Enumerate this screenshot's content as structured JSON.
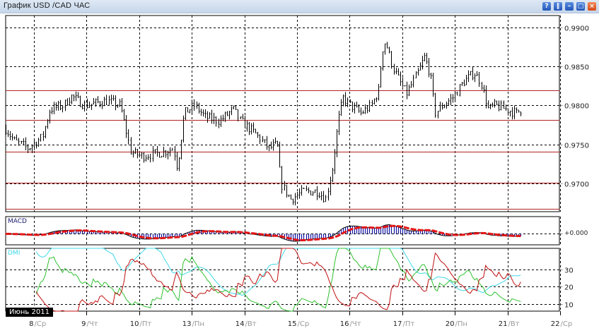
{
  "window": {
    "title": "График USD /CAD  ЧАС",
    "buttons": [
      {
        "name": "help",
        "glyph": "?"
      },
      {
        "name": "pause",
        "glyph": "‖"
      },
      {
        "name": "minimize",
        "glyph": "–"
      },
      {
        "name": "maximize",
        "glyph": "□"
      },
      {
        "name": "close",
        "glyph": "×"
      }
    ]
  },
  "colors": {
    "candle": "#000000",
    "level": "#b22222",
    "grid": "#000000",
    "macd_signal": "#e31515",
    "macd_hist": "#1010a0",
    "macd_line": "#000000",
    "adx": "#40d8e8",
    "plus_di": "#30c030",
    "minus_di": "#c01010",
    "macd_label": "#1a1a70",
    "dmi_label": "#40d8e8"
  },
  "price_axis": {
    "labels": [
      "0.9900",
      "0.9850",
      "0.9800",
      "0.9750",
      "0.9700"
    ],
    "values": [
      0.99,
      0.985,
      0.98,
      0.975,
      0.97
    ],
    "range": [
      0.9664,
      0.9915
    ]
  },
  "levels": [
    0.9819,
    0.9781,
    0.9741,
    0.9701,
    0.9668
  ],
  "macd_panel": {
    "label": "MACD",
    "zero_label": "+0.000"
  },
  "dmi_panel": {
    "label": "DMI",
    "labels": [
      "30",
      "20",
      "10"
    ],
    "values": [
      30,
      20,
      10
    ],
    "range": [
      6,
      42
    ]
  },
  "x_axis": {
    "month_label": "Июнь 2011",
    "days": [
      {
        "num": "8",
        "dow": "/Ср"
      },
      {
        "num": "9",
        "dow": "/Чт"
      },
      {
        "num": "10",
        "dow": "/Пт"
      },
      {
        "num": "13",
        "dow": "/Пн"
      },
      {
        "num": "14",
        "dow": "/Вт"
      },
      {
        "num": "15",
        "dow": "/Ср"
      },
      {
        "num": "16",
        "dow": "/Чт"
      },
      {
        "num": "17",
        "dow": "/Пт"
      },
      {
        "num": "20",
        "dow": "/Пн"
      },
      {
        "num": "21",
        "dow": "/Вт"
      },
      {
        "num": "22",
        "dow": "/Ср"
      }
    ]
  },
  "chart_data": {
    "type": "candlestick",
    "symbol": "USD/CAD",
    "timeframe": "H1",
    "x_unit": "trading days from 8 June",
    "key_closes": [
      [
        -0.54,
        0.977
      ],
      [
        -0.38,
        0.9755
      ],
      [
        -0.11,
        0.9745
      ],
      [
        0.16,
        0.976
      ],
      [
        0.3,
        0.9795
      ],
      [
        0.56,
        0.98
      ],
      [
        0.7,
        0.9812
      ],
      [
        0.97,
        0.98
      ],
      [
        1.37,
        0.9806
      ],
      [
        1.64,
        0.98
      ],
      [
        1.84,
        0.974
      ],
      [
        2.04,
        0.9735
      ],
      [
        2.45,
        0.974
      ],
      [
        2.65,
        0.9745
      ],
      [
        2.72,
        0.972
      ],
      [
        2.85,
        0.979
      ],
      [
        3.05,
        0.98
      ],
      [
        3.25,
        0.9785
      ],
      [
        3.52,
        0.978
      ],
      [
        3.79,
        0.9795
      ],
      [
        3.92,
        0.978
      ],
      [
        4.19,
        0.9765
      ],
      [
        4.46,
        0.9745
      ],
      [
        4.62,
        0.975
      ],
      [
        4.69,
        0.97
      ],
      [
        4.87,
        0.968
      ],
      [
        5.13,
        0.969
      ],
      [
        5.4,
        0.969
      ],
      [
        5.54,
        0.968
      ],
      [
        5.67,
        0.972
      ],
      [
        5.78,
        0.978
      ],
      [
        5.87,
        0.981
      ],
      [
        6.01,
        0.98
      ],
      [
        6.21,
        0.979
      ],
      [
        6.41,
        0.98
      ],
      [
        6.55,
        0.982
      ],
      [
        6.61,
        0.987
      ],
      [
        6.68,
        0.9882
      ],
      [
        6.81,
        0.985
      ],
      [
        6.95,
        0.983
      ],
      [
        7.08,
        0.9815
      ],
      [
        7.28,
        0.984
      ],
      [
        7.42,
        0.9862
      ],
      [
        7.53,
        0.984
      ],
      [
        7.62,
        0.979
      ],
      [
        7.76,
        0.98
      ],
      [
        7.96,
        0.981
      ],
      [
        8.16,
        0.983
      ],
      [
        8.36,
        0.9842
      ],
      [
        8.49,
        0.983
      ],
      [
        8.63,
        0.9795
      ],
      [
        8.76,
        0.98
      ],
      [
        8.97,
        0.9795
      ],
      [
        9.17,
        0.979
      ],
      [
        9.27,
        0.9795
      ]
    ]
  }
}
